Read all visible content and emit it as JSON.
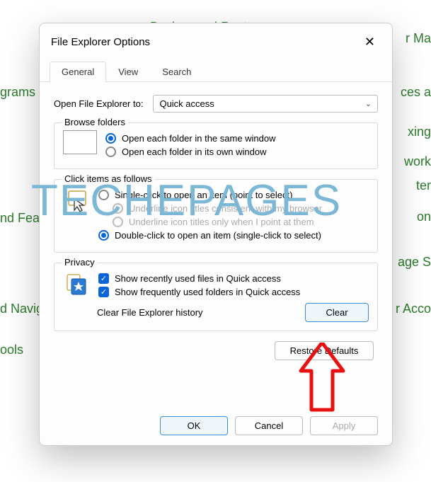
{
  "bg": {
    "backup": "Backup and Restore",
    "grams": "grams",
    "feat": "nd Fea",
    "navig": "d Navig",
    "ools": "ools",
    "rmai": "r Ma",
    "ces": "ces a",
    "xing": "xing",
    "work": "work",
    "ter": "ter",
    "on": "on",
    "ages": "age S",
    "acco": "r Acco"
  },
  "watermark": "TECHEPAGES",
  "dialog": {
    "title": "File Explorer Options",
    "tabs": {
      "general": "General",
      "view": "View",
      "search": "Search"
    },
    "open_label": "Open File Explorer to:",
    "open_value": "Quick access",
    "browse": {
      "title": "Browse folders",
      "same": "Open each folder in the same window",
      "own": "Open each folder in its own window"
    },
    "click": {
      "title": "Click items as follows",
      "single": "Single-click to open an item (point to select)",
      "underline_browser": "Underline icon titles consistent with my browser",
      "underline_point": "Underline icon titles only when I point at them",
      "double": "Double-click to open an item (single-click to select)"
    },
    "privacy": {
      "title": "Privacy",
      "recent": "Show recently used files in Quick access",
      "frequent": "Show frequently used folders in Quick access",
      "clear_label": "Clear File Explorer history",
      "clear_btn": "Clear"
    },
    "restore": "Restore Defaults",
    "ok": "OK",
    "cancel": "Cancel",
    "apply": "Apply"
  }
}
